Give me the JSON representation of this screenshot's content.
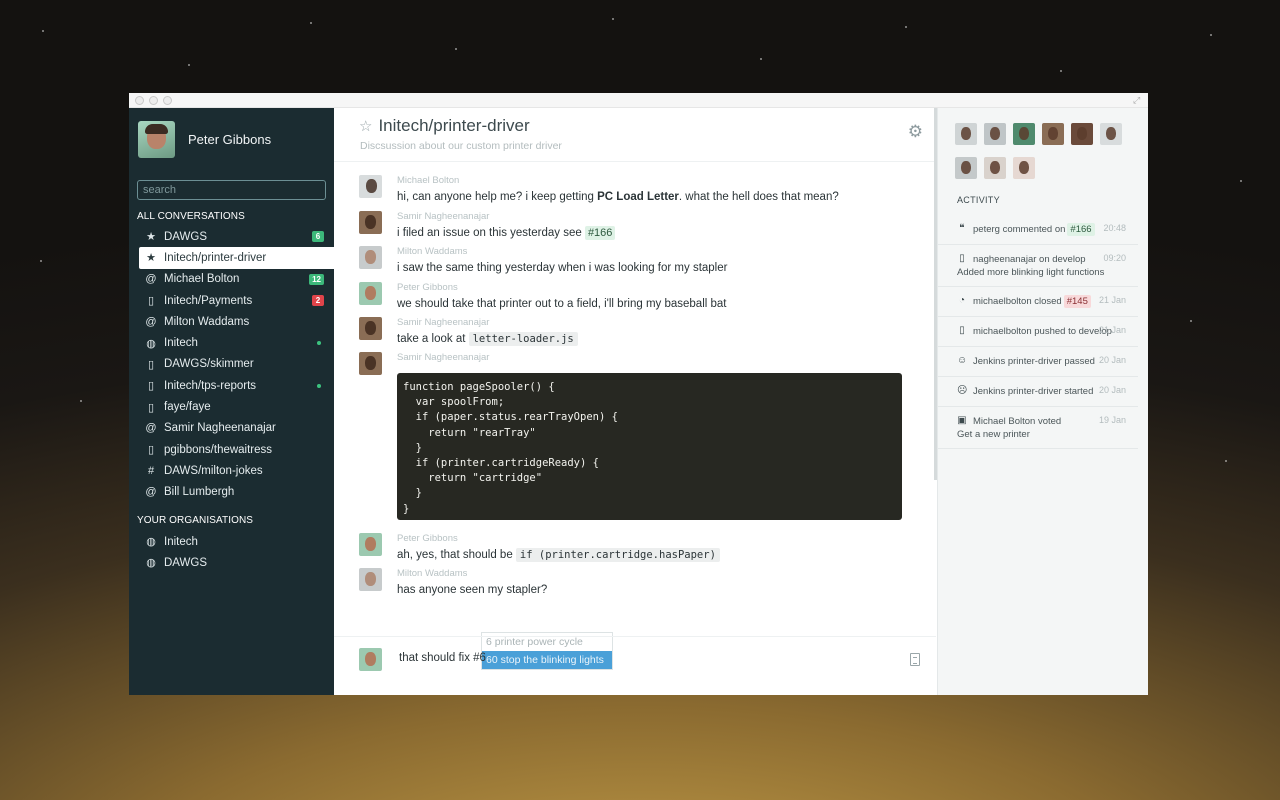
{
  "user": {
    "name": "Peter Gibbons"
  },
  "search": {
    "placeholder": "search"
  },
  "sidebar": {
    "all_heading": "ALL CONVERSATIONS",
    "conversations": [
      {
        "icon": "star-icon",
        "glyph": "★",
        "label": "DAWGS",
        "badge": "6",
        "badge_color": "green"
      },
      {
        "icon": "star-icon",
        "glyph": "★",
        "label": "Initech/printer-driver",
        "active": true
      },
      {
        "icon": "at-icon",
        "glyph": "@",
        "label": "Michael Bolton",
        "badge": "12",
        "badge_color": "green"
      },
      {
        "icon": "repo-icon",
        "glyph": "▯",
        "label": "Initech/Payments",
        "badge": "2",
        "badge_color": "red"
      },
      {
        "icon": "at-icon",
        "glyph": "@",
        "label": "Milton Waddams"
      },
      {
        "icon": "org-icon",
        "glyph": "◍",
        "label": "Initech",
        "dot": true
      },
      {
        "icon": "repo-icon",
        "glyph": "▯",
        "label": "DAWGS/skimmer"
      },
      {
        "icon": "repo-icon",
        "glyph": "▯",
        "label": "Initech/tps-reports",
        "dot": true
      },
      {
        "icon": "repo-icon",
        "glyph": "▯",
        "label": "faye/faye"
      },
      {
        "icon": "at-icon",
        "glyph": "@",
        "label": "Samir Nagheenanajar"
      },
      {
        "icon": "repo-icon",
        "glyph": "▯",
        "label": "pgibbons/thewaitress"
      },
      {
        "icon": "hash-icon",
        "glyph": "#",
        "label": "DAWS/milton-jokes"
      },
      {
        "icon": "at-icon",
        "glyph": "@",
        "label": "Bill Lumbergh"
      }
    ],
    "orgs_heading": "YOUR ORGANISATIONS",
    "organisations": [
      {
        "icon": "org-icon",
        "glyph": "◍",
        "label": "Initech"
      },
      {
        "icon": "org-icon",
        "glyph": "◍",
        "label": "DAWGS"
      }
    ]
  },
  "room": {
    "title": "Initech/printer-driver",
    "topic": "Discsussion about our custom printer driver"
  },
  "messages": [
    {
      "author": "Michael Bolton",
      "pre": "hi, can anyone help me? i keep getting ",
      "bold": "PC Load Letter",
      "post": ". what the hell does that mean?"
    },
    {
      "author": "Samir Nagheenanajar",
      "pre": "i filed an issue on this yesterday see ",
      "tag": "#166"
    },
    {
      "author": "Milton Waddams",
      "text": "i saw the same thing yesterday when i was looking for my stapler"
    },
    {
      "author": "Peter Gibbons",
      "text": "we should take that printer out to a field, i'll bring my baseball bat"
    },
    {
      "author": "Samir Nagheenanajar",
      "pre": "take a look at ",
      "code": "letter-loader.js"
    },
    {
      "author": "Samir Nagheenanajar"
    },
    {
      "author": "Peter Gibbons",
      "pre": "ah, yes, that should be ",
      "code": "if (printer.cartridge.hasPaper)"
    },
    {
      "author": "Milton Waddams",
      "text": "has anyone seen my stapler?"
    }
  ],
  "code_block": {
    "lines": [
      "function pageSpooler() {",
      "  var spoolFrom;",
      "  if (paper.status.rearTrayOpen) {",
      "    return \"rearTray\"",
      "  }",
      "  if (printer.cartridgeReady) {",
      "    return \"cartridge\"",
      "  }",
      "}"
    ]
  },
  "autocomplete": [
    {
      "label": "6 printer power cycle"
    },
    {
      "label": "60 stop the blinking lights",
      "selected": true
    }
  ],
  "composer": {
    "value": "that should fix #6"
  },
  "activity": {
    "heading": "ACTIVITY",
    "items": [
      {
        "icon": "comment-icon",
        "glyph": "❝",
        "text": "peterg commented on",
        "tag": "#166",
        "tag_color": "green",
        "time": "20:48"
      },
      {
        "icon": "repo-icon",
        "glyph": "▯",
        "text": "nagheenanajar on develop",
        "sub": "Added more blinking light functions",
        "time": "09:20"
      },
      {
        "icon": "issue-closed-icon",
        "glyph": "◔",
        "text": "michaelbolton closed",
        "tag": "#145",
        "tag_color": "red",
        "time": "21 Jan"
      },
      {
        "icon": "repo-icon",
        "glyph": "▯",
        "text": "michaelbolton pushed to develop",
        "time": "21 Jan"
      },
      {
        "icon": "smiley-icon",
        "glyph": "☺",
        "text": "Jenkins printer-driver passed",
        "time": "20 Jan"
      },
      {
        "icon": "frown-icon",
        "glyph": "☹",
        "text": "Jenkins printer-driver started",
        "time": "20 Jan"
      },
      {
        "icon": "vote-icon",
        "glyph": "▣",
        "text": "Michael Bolton voted",
        "sub": "Get a new printer",
        "time": "19 Jan"
      }
    ]
  },
  "colors": {
    "sidebar_bg": "#1b2c31",
    "badge_green": "#3cb87a",
    "badge_red": "#e0444a",
    "autocomplete_selected": "#4aa0d8",
    "code_bg": "#272822"
  }
}
